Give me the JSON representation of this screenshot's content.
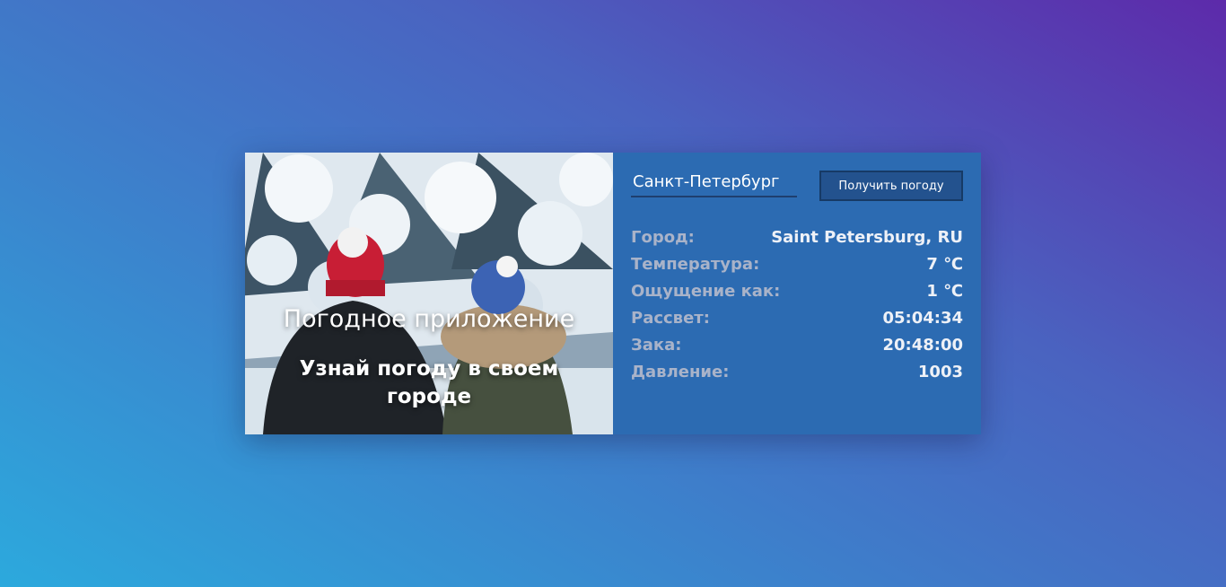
{
  "photo": {
    "title": "Погодное приложение",
    "subtitle": "Узнай погоду в своем городе"
  },
  "search": {
    "value": "Санкт-Петербург",
    "button_label": "Получить погоду"
  },
  "weather": {
    "rows": [
      {
        "label": "Город:",
        "value": "Saint Petersburg, RU"
      },
      {
        "label": "Температура:",
        "value": "7 ℃"
      },
      {
        "label": "Ощущение как:",
        "value": "1 ℃"
      },
      {
        "label": "Рассвет:",
        "value": "05:04:34"
      },
      {
        "label": "Зака:",
        "value": "20:48:00"
      },
      {
        "label": "Давление:",
        "value": "1003"
      }
    ]
  }
}
